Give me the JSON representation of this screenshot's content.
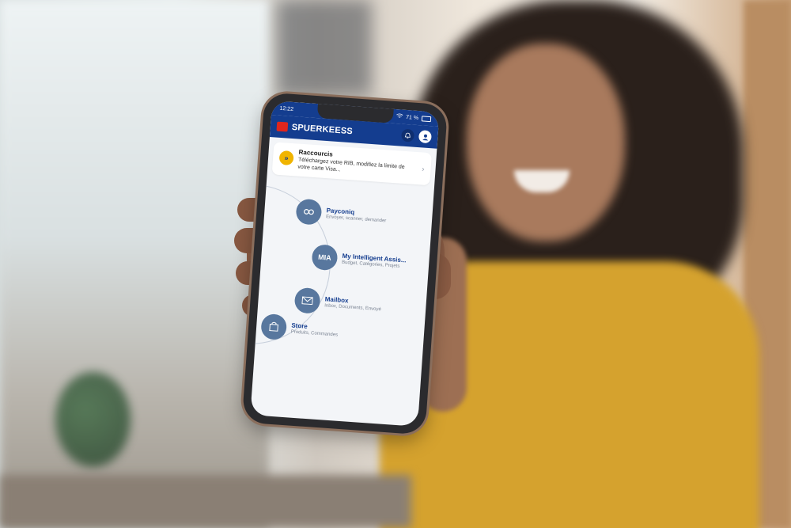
{
  "status": {
    "time": "12:22",
    "battery": "71 %"
  },
  "header": {
    "brand": "SPUERKEESS"
  },
  "shortcut": {
    "title": "Raccourcis",
    "description": "Téléchargez votre RIB, modifiez la limite de votre carte Visa..."
  },
  "menu": {
    "items": [
      {
        "name": "Payconiq",
        "subtitle": "Envoyer, scanner, demander",
        "icon": "link-icon"
      },
      {
        "name": "My Intelligent Assis...",
        "subtitle": "Budget, Catégories, Projets",
        "icon_text": "MIA"
      },
      {
        "name": "Mailbox",
        "subtitle": "Inbox, Documents, Envoyé",
        "icon": "mail-icon"
      },
      {
        "name": "Store",
        "subtitle": "Produits, Commandes",
        "icon": "shopping-bag-icon"
      }
    ]
  },
  "colors": {
    "brand_blue": "#143d8f",
    "accent_yellow": "#f0b400",
    "menu_circle": "#58779e"
  }
}
